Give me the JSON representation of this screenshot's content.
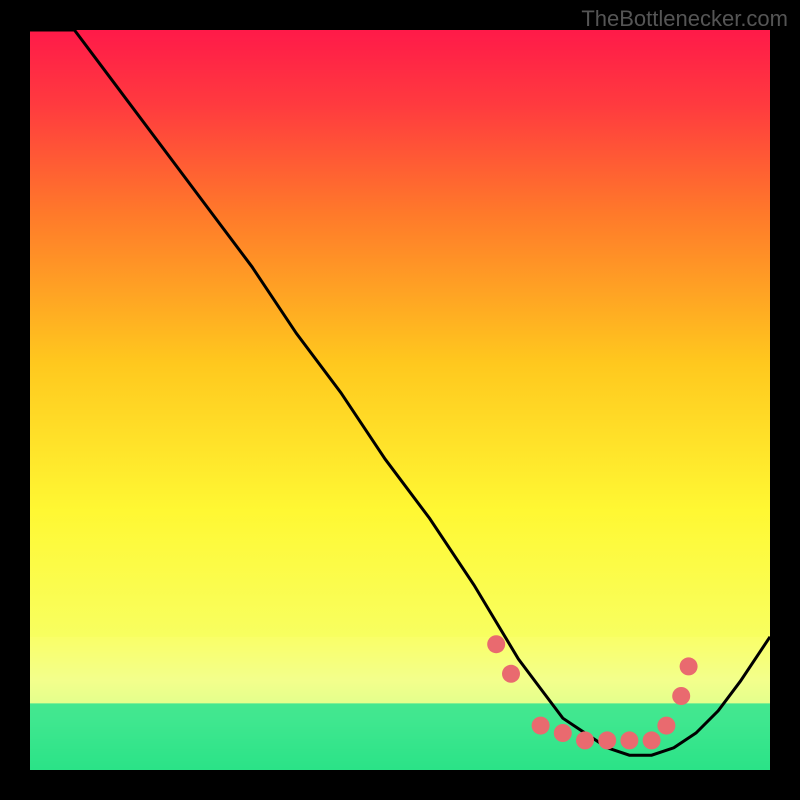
{
  "watermark": "TheBottlenecker.com",
  "chart_data": {
    "type": "line",
    "title": "",
    "xlabel": "",
    "ylabel": "",
    "xlim": [
      0,
      100
    ],
    "ylim": [
      0,
      100
    ],
    "series": [
      {
        "name": "curve",
        "x": [
          0,
          6,
          12,
          18,
          24,
          30,
          36,
          42,
          48,
          54,
          60,
          63,
          66,
          69,
          72,
          75,
          78,
          81,
          84,
          87,
          90,
          93,
          96,
          100
        ],
        "y": [
          100,
          100,
          92,
          84,
          76,
          68,
          59,
          51,
          42,
          34,
          25,
          20,
          15,
          11,
          7,
          5,
          3,
          2,
          2,
          3,
          5,
          8,
          12,
          18
        ]
      }
    ],
    "marker_points": {
      "x": [
        63,
        65,
        69,
        72,
        75,
        78,
        81,
        84,
        86,
        88,
        89
      ],
      "y": [
        17,
        13,
        6,
        5,
        4,
        4,
        4,
        4,
        6,
        10,
        14
      ]
    },
    "green_band": {
      "y_bottom": 0,
      "y_top": 9
    },
    "yellow_band": {
      "y_bottom": 9,
      "y_top": 18
    },
    "gradient_stops": [
      {
        "offset": 0.0,
        "color": "#ff1a49"
      },
      {
        "offset": 0.1,
        "color": "#ff3a3f"
      },
      {
        "offset": 0.25,
        "color": "#ff7a2a"
      },
      {
        "offset": 0.45,
        "color": "#ffc81e"
      },
      {
        "offset": 0.65,
        "color": "#fff833"
      },
      {
        "offset": 0.82,
        "color": "#f8ff60"
      },
      {
        "offset": 0.88,
        "color": "#e8ffb0"
      },
      {
        "offset": 0.93,
        "color": "#b0ffb0"
      },
      {
        "offset": 1.0,
        "color": "#20e07a"
      }
    ],
    "marker_color": "#e96a6f"
  }
}
